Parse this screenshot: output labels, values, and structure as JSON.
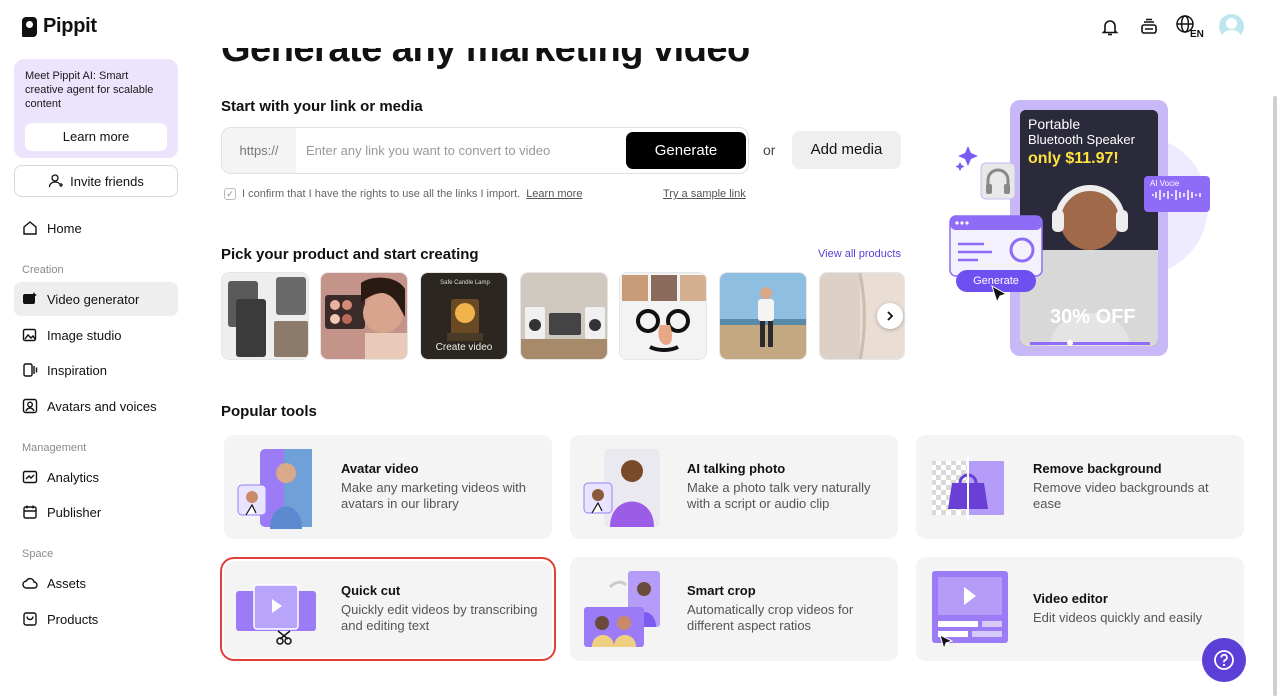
{
  "brand": {
    "name": "Pippit"
  },
  "promo": {
    "text": "Meet Pippit AI: Smart creative agent for scalable content",
    "button": "Learn more"
  },
  "invite": {
    "label": "Invite friends"
  },
  "nav": {
    "home": "Home",
    "section_creation": "Creation",
    "video_generator": "Video generator",
    "image_studio": "Image studio",
    "inspiration": "Inspiration",
    "avatars_voices": "Avatars and voices",
    "section_management": "Management",
    "analytics": "Analytics",
    "publisher": "Publisher",
    "section_space": "Space",
    "assets": "Assets",
    "products": "Products"
  },
  "topbar": {
    "lang": "EN"
  },
  "hero": {
    "title": "Generate any marketing video"
  },
  "link_section": {
    "heading": "Start with your link or media",
    "prefix": "https://",
    "placeholder": "Enter any link you want to convert to video",
    "generate": "Generate",
    "or": "or",
    "add_media": "Add media",
    "confirm_text": "I confirm that I have the rights to use all the links I import.",
    "confirm_link": "Learn more",
    "sample_link": "Try a sample link"
  },
  "products_section": {
    "heading": "Pick your product and start creating",
    "view_all": "View all products",
    "items": [
      {
        "name": "tablet-case"
      },
      {
        "name": "makeup-palette"
      },
      {
        "name": "candle-lamp",
        "caption": "Create video",
        "label": "Safe Candle Lamp"
      },
      {
        "name": "speakers"
      },
      {
        "name": "novelty-glasses"
      },
      {
        "name": "beach-person"
      },
      {
        "name": "skin-closeup"
      }
    ]
  },
  "hero_image": {
    "title_line1": "Portable",
    "title_line2": "Bluetooth Speaker",
    "price": "only $11.97!",
    "discount": "30% OFF",
    "generate_badge": "Generate",
    "ai_voice": "AI Vocie"
  },
  "tools_section": {
    "heading": "Popular tools",
    "tools": [
      {
        "title": "Avatar video",
        "desc": "Make any marketing videos with avatars in our library"
      },
      {
        "title": "AI talking photo",
        "desc": "Make a photo talk very naturally with a script or audio clip"
      },
      {
        "title": "Remove background",
        "desc": "Remove video backgrounds at ease"
      },
      {
        "title": "Quick cut",
        "desc": "Quickly edit videos by transcribing and editing text"
      },
      {
        "title": "Smart crop",
        "desc": "Automatically crop videos for different aspect ratios"
      },
      {
        "title": "Video editor",
        "desc": "Edit videos quickly and easily"
      }
    ]
  },
  "colors": {
    "accent": "#5b3fd6",
    "highlight": "#e2403a",
    "promo_bg": "#ece3fd"
  }
}
